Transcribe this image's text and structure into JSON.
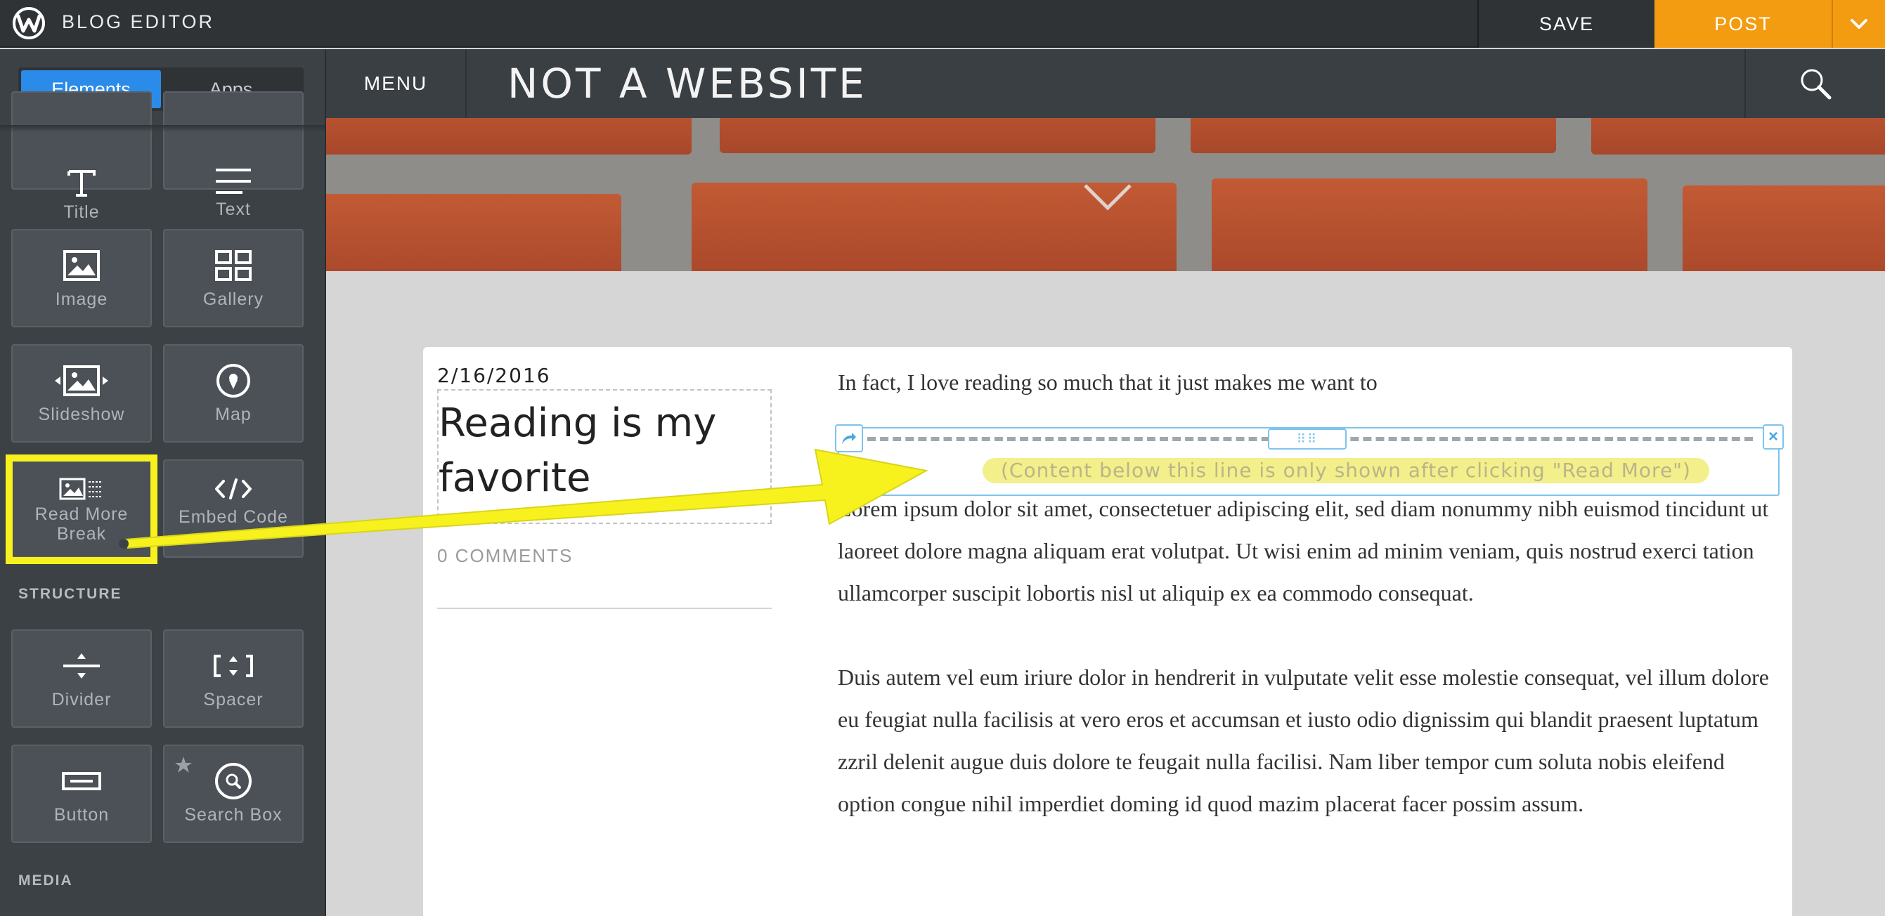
{
  "app": {
    "title": "BLOG EDITOR",
    "save_label": "SAVE",
    "post_label": "POST"
  },
  "sidebar": {
    "tabs": [
      {
        "label": "Elements",
        "active": true
      },
      {
        "label": "Apps",
        "active": false
      }
    ],
    "basic_tiles": [
      {
        "label": "Title",
        "icon": "title-icon"
      },
      {
        "label": "Text",
        "icon": "text-icon"
      },
      {
        "label": "Image",
        "icon": "image-icon"
      },
      {
        "label": "Gallery",
        "icon": "gallery-icon"
      },
      {
        "label": "Slideshow",
        "icon": "slideshow-icon"
      },
      {
        "label": "Map",
        "icon": "map-pin-icon"
      },
      {
        "label": "Read More Break",
        "icon": "read-more-break-icon"
      },
      {
        "label": "Embed Code",
        "icon": "embed-code-icon"
      }
    ],
    "structure_label": "STRUCTURE",
    "structure_tiles": [
      {
        "label": "Divider",
        "icon": "divider-icon"
      },
      {
        "label": "Spacer",
        "icon": "spacer-icon"
      },
      {
        "label": "Button",
        "icon": "button-icon"
      },
      {
        "label": "Search Box",
        "icon": "search-box-icon",
        "premium": true
      }
    ],
    "media_label": "MEDIA"
  },
  "editor": {
    "menu_label": "MENU",
    "site_title": "NOT A WEBSITE"
  },
  "post": {
    "date": "2/16/2016",
    "title": "Reading is my favorite",
    "comments": "0 COMMENTS",
    "intro": "In fact, I love reading so much that it just makes me want to",
    "read_more_note": "(Content below this line is only shown after clicking \"Read More\")",
    "paragraph1": "Lorem ipsum dolor sit amet, consectetuer adipiscing elit, sed diam nonummy nibh euismod tincidunt ut laoreet dolore magna aliquam erat volutpat. Ut wisi enim ad minim veniam, quis nostrud exerci tation ullamcorper suscipit lobortis nisl ut aliquip ex ea commodo consequat.",
    "paragraph2": "Duis autem vel eum iriure dolor in hendrerit in vulputate velit esse molestie consequat, vel illum dolore eu feugiat nulla facilisis at vero eros et accumsan et iusto odio dignissim qui blandit praesent luptatum zzril delenit augue duis dolore te feugait nulla facilisi. Nam liber tempor cum soluta nobis eleifend option congue nihil imperdiet doming id quod mazim placerat facer possim assum."
  },
  "colors": {
    "accent_blue": "#2b8be8",
    "post_orange": "#f39c12",
    "annotation_yellow": "#f7f21d"
  }
}
